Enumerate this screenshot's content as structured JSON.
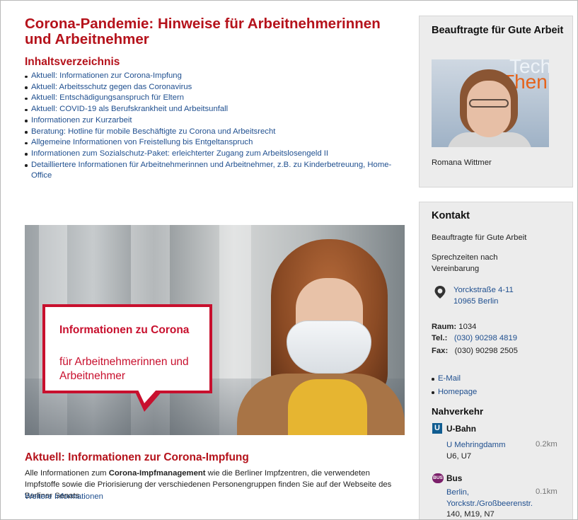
{
  "main": {
    "title": "Corona-Pandemie: Hinweise für Arbeitnehmerinnen und Arbeitnehmer",
    "toc_title": "Inhaltsverzeichnis",
    "toc": [
      "Aktuell: Informationen zur Corona-Impfung",
      "Aktuell: Arbeitsschutz gegen das Coronavirus",
      "Aktuell: Entschädigungsanspruch für Eltern",
      "Aktuell: COVID-19 als Berufskrankheit und Arbeitsunfall",
      "Informationen zur Kurzarbeit",
      "Beratung: Hotline für mobile Beschäftigte zu Corona und Arbeitsrecht",
      "Allgemeine Informationen von Freistellung bis Entgeltanspruch",
      "Informationen zum Sozialschutz-Paket: erleichterter Zugang zum Arbeitslosengeld II",
      "Detailliertere Informationen für Arbeitnehmerinnen und Arbeitnehmer, z.B. zu Kinderbetreuung, Home-Office"
    ],
    "hero": {
      "line1": "Informationen zu Corona",
      "line2": "für Arbeitnehmerinnen und Arbeitnehmer"
    },
    "section": {
      "title": "Aktuell: Informationen zur Corona-Impfung",
      "text_before": "Alle Informationen zum ",
      "text_bold": "Corona-Impfmanagement",
      "text_after": " wie die Berliner Impfzentren, die verwendeten Impfstoffe sowie die Priorisierung der verschiedenen Personengruppen finden Sie auf der Webseite des Berliner Senats.",
      "link": "Weitere Informationen"
    }
  },
  "sidebar": {
    "person_box": {
      "title": "Beauftragte für Gute Arbeit",
      "photo_text1": "Tech",
      "photo_text2": "Then",
      "name": "Romana Wittmer"
    },
    "contact": {
      "title": "Kontakt",
      "org": "Beauftragte für Gute Arbeit",
      "hours": "Sprechzeiten nach Vereinbarung",
      "address_line1": "Yorckstraße 4-11",
      "address_line2": "10965 Berlin",
      "room_label": "Raum:",
      "room": "1034",
      "tel_label": "Tel.:",
      "tel": "(030) 90298 4819",
      "fax_label": "Fax:",
      "fax": "(030) 90298 2505",
      "links": [
        "E-Mail",
        "Homepage"
      ],
      "transit_title": "Nahverkehr",
      "ubahn": {
        "badge": "U",
        "label": "U-Bahn",
        "stop": "U Mehringdamm",
        "lines": "U6, U7",
        "distance": "0.2km"
      },
      "bus": {
        "badge": "BUS",
        "label": "Bus",
        "stop": "Berlin, Yorckstr./Großbeerenstr.",
        "lines": "140, M19, N7",
        "distance": "0.1km"
      }
    }
  }
}
